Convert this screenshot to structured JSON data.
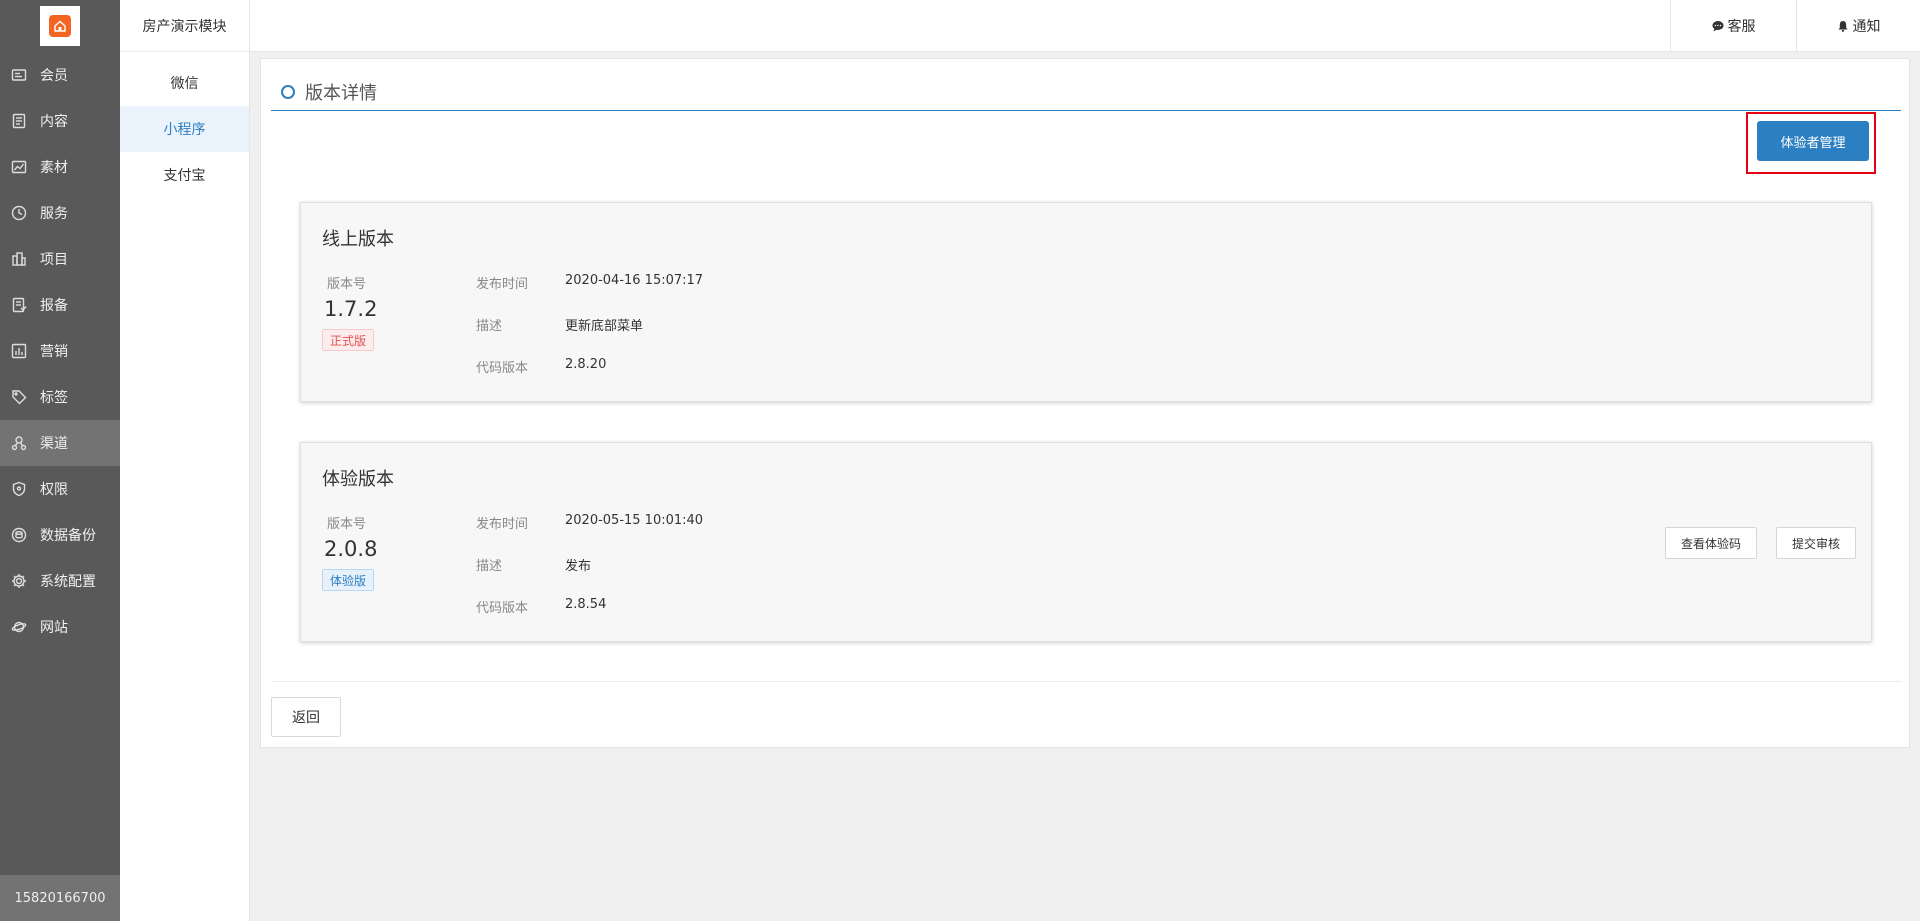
{
  "sidebar": {
    "items": [
      {
        "label": "会员",
        "icon": "member-card-icon"
      },
      {
        "label": "内容",
        "icon": "document-icon"
      },
      {
        "label": "素材",
        "icon": "chart-image-icon"
      },
      {
        "label": "服务",
        "icon": "clock-icon"
      },
      {
        "label": "项目",
        "icon": "building-icon"
      },
      {
        "label": "报备",
        "icon": "report-icon"
      },
      {
        "label": "营销",
        "icon": "marketing-chart-icon"
      },
      {
        "label": "标签",
        "icon": "tag-icon"
      },
      {
        "label": "渠道",
        "icon": "channel-icon"
      },
      {
        "label": "权限",
        "icon": "shield-icon"
      },
      {
        "label": "数据备份",
        "icon": "database-icon"
      },
      {
        "label": "系统配置",
        "icon": "gear-icon"
      },
      {
        "label": "网站",
        "icon": "planet-icon"
      }
    ],
    "active_index": 8,
    "footer_phone": "15820166700"
  },
  "submenu": {
    "title": "房产演示模块",
    "items": [
      "微信",
      "小程序",
      "支付宝"
    ],
    "active_index": 1
  },
  "topbar": {
    "service_label": "客服",
    "notify_label": "通知"
  },
  "main": {
    "title": "版本详情",
    "tester_button": "体验者管理",
    "online": {
      "card_title": "线上版本",
      "version_label": "版本号",
      "version": "1.7.2",
      "badge": "正式版",
      "publish_time_label": "发布时间",
      "publish_time": "2020-04-16 15:07:17",
      "desc_label": "描述",
      "desc": "更新底部菜单",
      "code_version_label": "代码版本",
      "code_version": "2.8.20"
    },
    "trial": {
      "card_title": "体验版本",
      "version_label": "版本号",
      "version": "2.0.8",
      "badge": "体验版",
      "publish_time_label": "发布时间",
      "publish_time": "2020-05-15 10:01:40",
      "desc_label": "描述",
      "desc": "发布",
      "code_version_label": "代码版本",
      "code_version": "2.8.54",
      "view_qr_button": "查看体验码",
      "submit_review_button": "提交审核"
    },
    "back_button": "返回"
  },
  "colors": {
    "sidebar_bg": "#595959",
    "primary": "#2c7fc2",
    "highlight_border": "#e60012",
    "logo_orange": "#f26522"
  }
}
